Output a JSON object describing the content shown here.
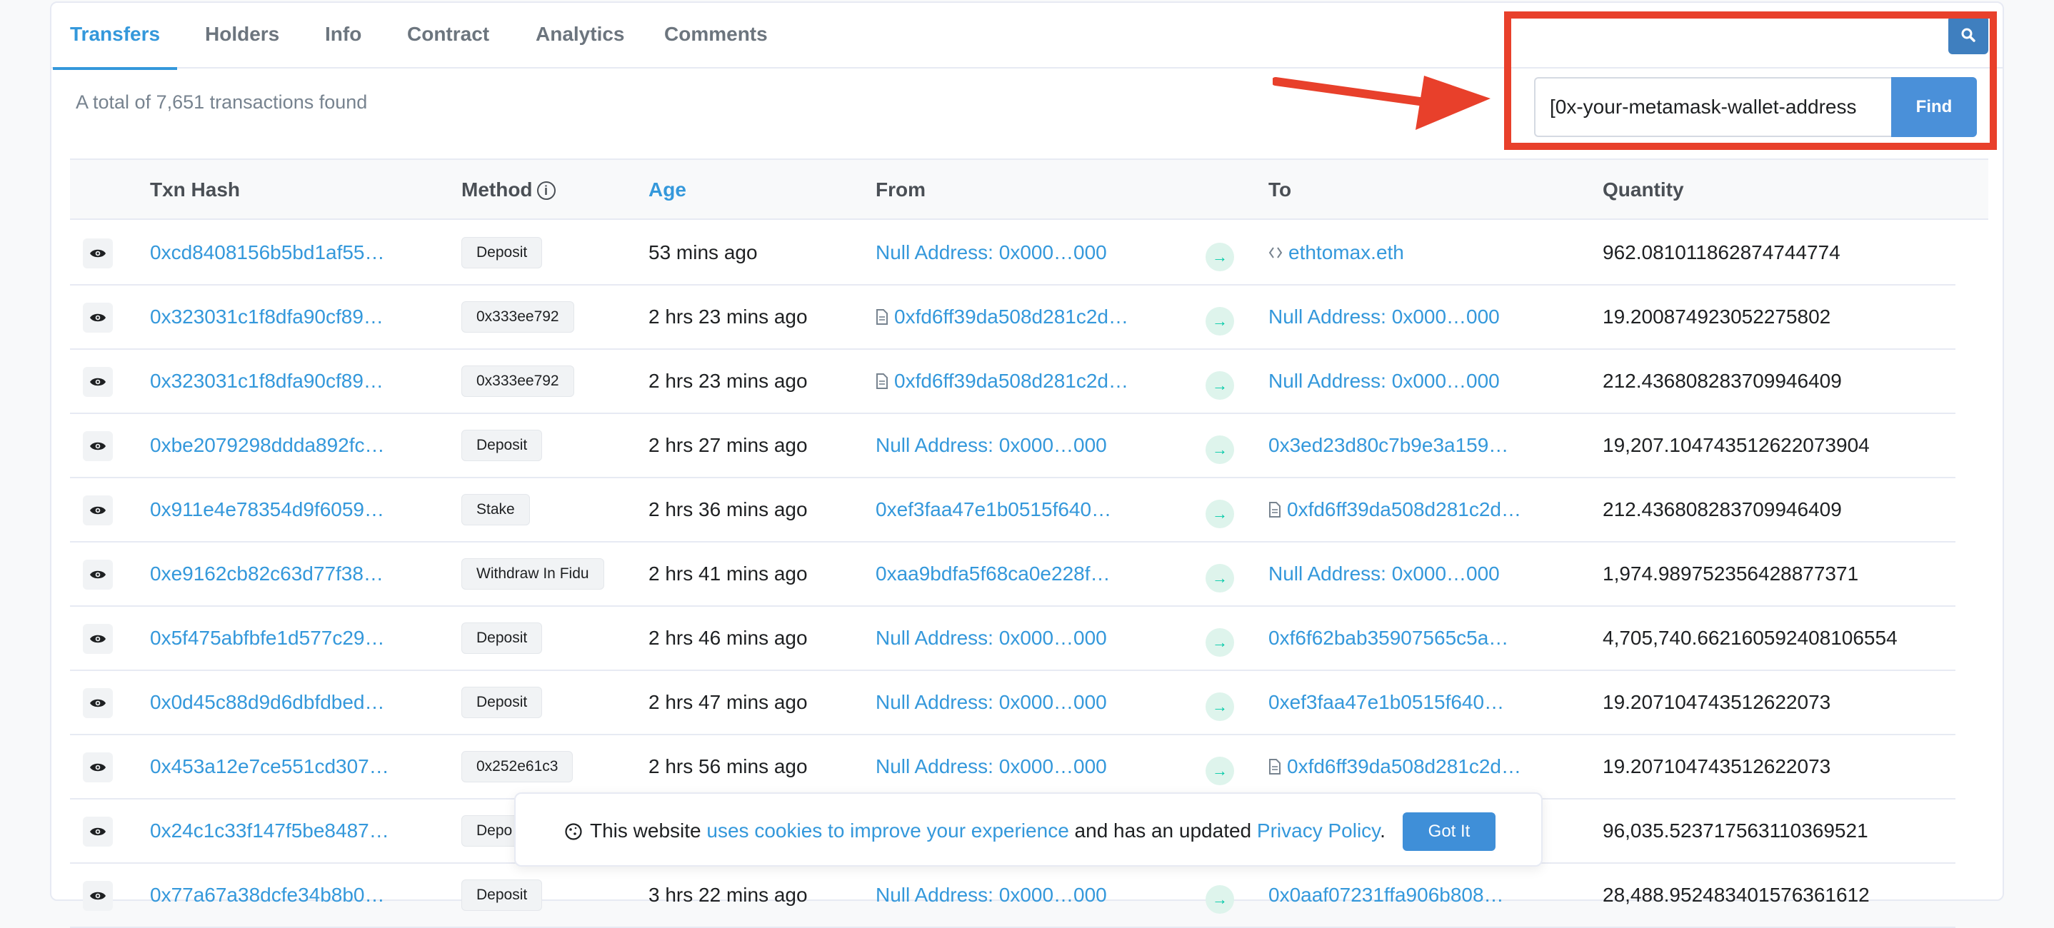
{
  "tabs": [
    {
      "label": "Transfers"
    },
    {
      "label": "Holders"
    },
    {
      "label": "Info"
    },
    {
      "label": "Contract"
    },
    {
      "label": "Analytics"
    },
    {
      "label": "Comments"
    }
  ],
  "summary": "A total of 7,651 transactions found",
  "filter": {
    "value": "[0x-your-metamask-wallet-address",
    "find_label": "Find"
  },
  "table": {
    "headers": {
      "txn_hash": "Txn Hash",
      "method": "Method",
      "age": "Age",
      "from": "From",
      "to": "To",
      "quantity": "Quantity"
    },
    "rows": [
      {
        "hash": "0xcd8408156b5bd1af55…",
        "method": "Deposit",
        "age": "53 mins ago",
        "from": "Null Address: 0x000…000",
        "to": "ethtomax.eth",
        "quantity": "962.081011862874744774"
      },
      {
        "hash": "0x323031c1f8dfa90cf89…",
        "method": "0x333ee792",
        "age": "2 hrs 23 mins ago",
        "from": "0xfd6ff39da508d281c2d…",
        "to": "Null Address: 0x000…000",
        "quantity": "19.200874923052275802"
      },
      {
        "hash": "0x323031c1f8dfa90cf89…",
        "method": "0x333ee792",
        "age": "2 hrs 23 mins ago",
        "from": "0xfd6ff39da508d281c2d…",
        "to": "Null Address: 0x000…000",
        "quantity": "212.436808283709946409"
      },
      {
        "hash": "0xbe2079298ddda892fc…",
        "method": "Deposit",
        "age": "2 hrs 27 mins ago",
        "from": "Null Address: 0x000…000",
        "to": "0x3ed23d80c7b9e3a159…",
        "quantity": "19,207.104743512622073904"
      },
      {
        "hash": "0x911e4e78354d9f6059…",
        "method": "Stake",
        "age": "2 hrs 36 mins ago",
        "from": "0xef3faa47e1b0515f640…",
        "to": "0xfd6ff39da508d281c2d…",
        "quantity": "212.436808283709946409"
      },
      {
        "hash": "0xe9162cb82c63d77f38…",
        "method": "Withdraw In Fidu",
        "age": "2 hrs 41 mins ago",
        "from": "0xaa9bdfa5f68ca0e228f…",
        "to": "Null Address: 0x000…000",
        "quantity": "1,974.989752356428877371"
      },
      {
        "hash": "0x5f475abfbfe1d577c29…",
        "method": "Deposit",
        "age": "2 hrs 46 mins ago",
        "from": "Null Address: 0x000…000",
        "to": "0xf6f62bab35907565c5a…",
        "quantity": "4,705,740.662160592408106554"
      },
      {
        "hash": "0x0d45c88d9d6dbfdbed…",
        "method": "Deposit",
        "age": "2 hrs 47 mins ago",
        "from": "Null Address: 0x000…000",
        "to": "0xef3faa47e1b0515f640…",
        "quantity": "19.207104743512622073"
      },
      {
        "hash": "0x453a12e7ce551cd307…",
        "method": "0x252e61c3",
        "age": "2 hrs 56 mins ago",
        "from": "Null Address: 0x000…000",
        "to": "0xfd6ff39da508d281c2d…",
        "quantity": "19.207104743512622073"
      },
      {
        "hash": "0x24c1c33f147f5be8487…",
        "method": "Depo",
        "age": "",
        "from": "",
        "to": "",
        "quantity": "96,035.523717563110369521"
      },
      {
        "hash": "0x77a67a38dcfe34b8b0…",
        "method": "Deposit",
        "age": "3 hrs 22 mins ago",
        "from": "Null Address: 0x000…000",
        "to": "0x0aaf07231ffa906b808…",
        "quantity": "28,488.952483401576361612"
      }
    ]
  },
  "cookie": {
    "text_before": "This website ",
    "link1": "uses cookies to improve your experience",
    "text_middle": " and has an updated ",
    "link2": "Privacy Policy",
    "text_after": ".",
    "button": "Got It"
  },
  "colors": {
    "accent": "#3498db",
    "highlight": "#e8402b",
    "arrow_badge": "#00c9a7"
  }
}
